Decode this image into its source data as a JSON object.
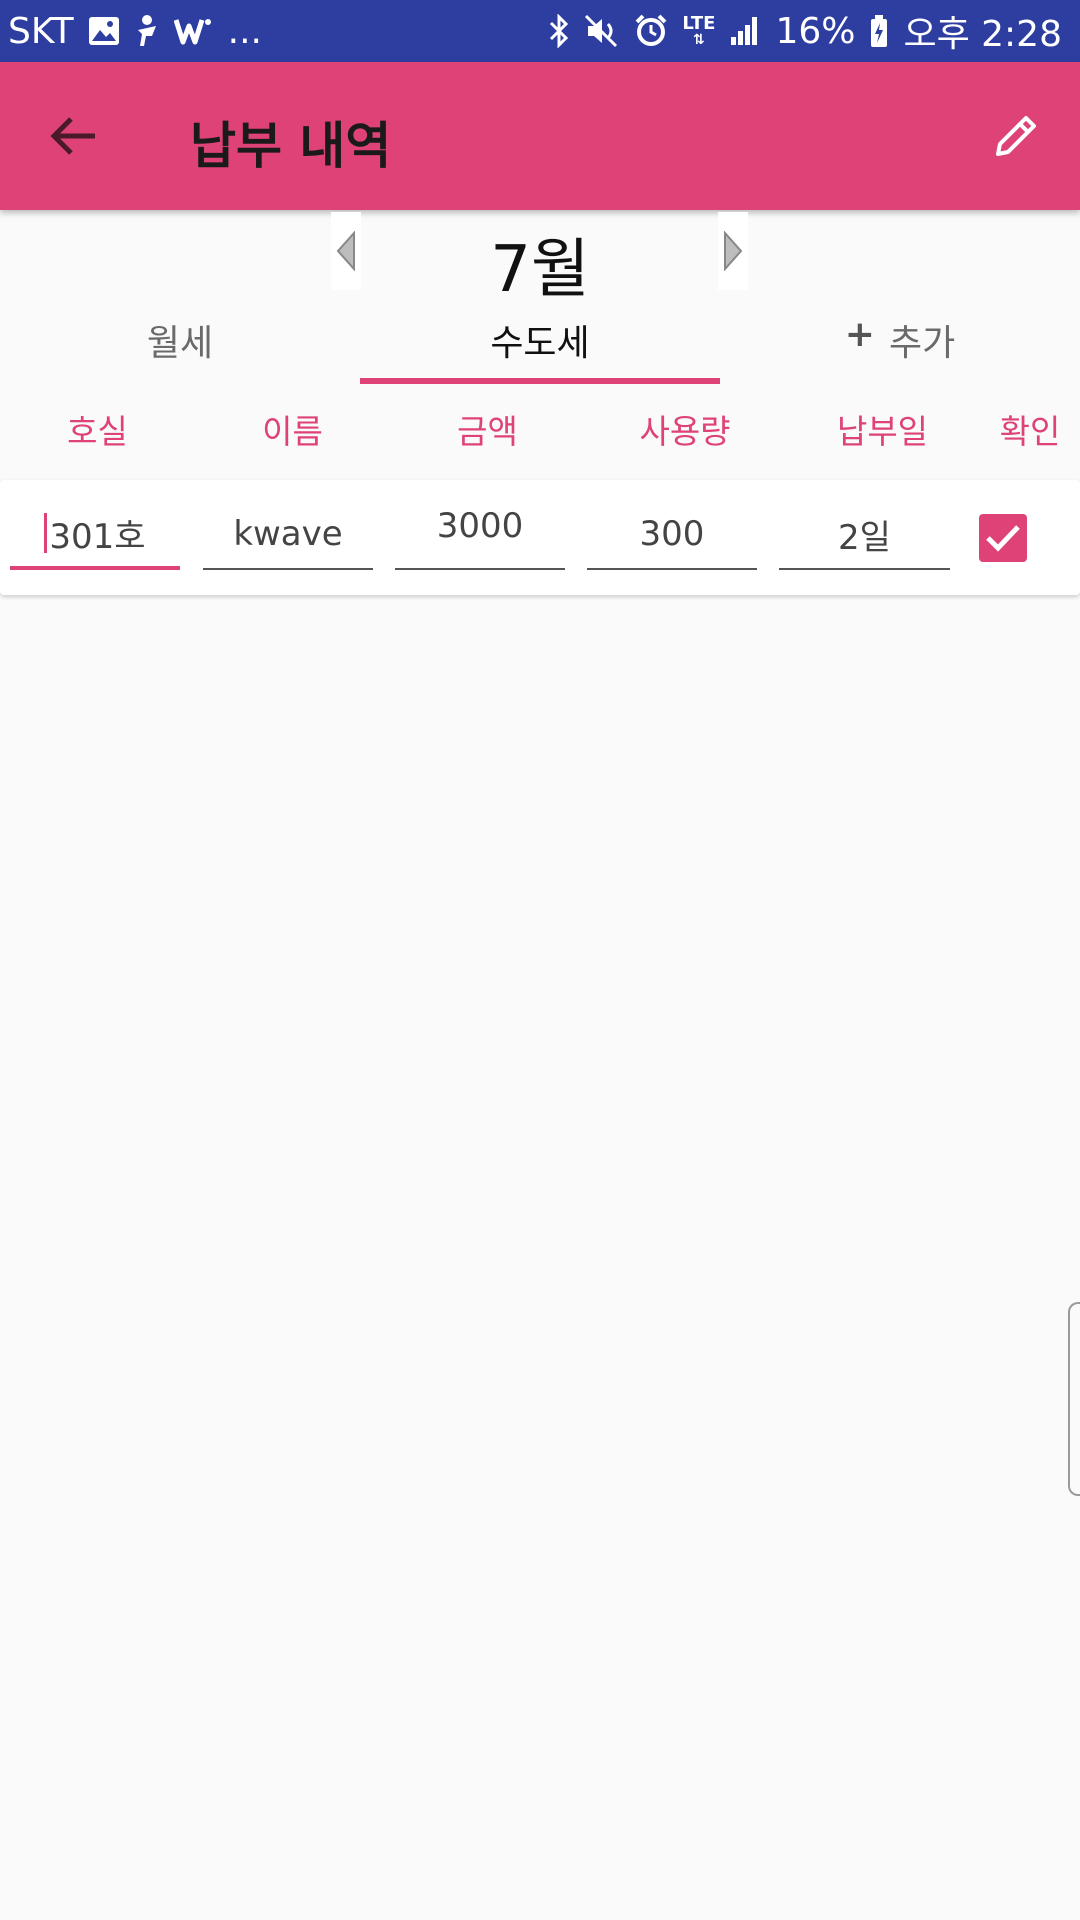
{
  "status_bar": {
    "carrier": "SKT",
    "more": "...",
    "network": "LTE",
    "battery": "16%",
    "time": "오후 2:28"
  },
  "app_bar": {
    "title": "납부 내역"
  },
  "month": {
    "label": "7월"
  },
  "tabs": [
    {
      "label": "월세",
      "selected": false
    },
    {
      "label": "수도세",
      "selected": true
    },
    {
      "label": "추가",
      "prefix": "+",
      "selected": false
    }
  ],
  "columns": [
    "호실",
    "이름",
    "금액",
    "사용량",
    "납부일",
    "확인"
  ],
  "rows": [
    {
      "room": "301호",
      "name": "kwave",
      "amount": "3000",
      "usage": "300",
      "pay_day": "2일",
      "confirmed": true
    }
  ],
  "colors": {
    "status_bar": "#2d3ea0",
    "primary": "#de4277",
    "background": "#fafafa"
  }
}
